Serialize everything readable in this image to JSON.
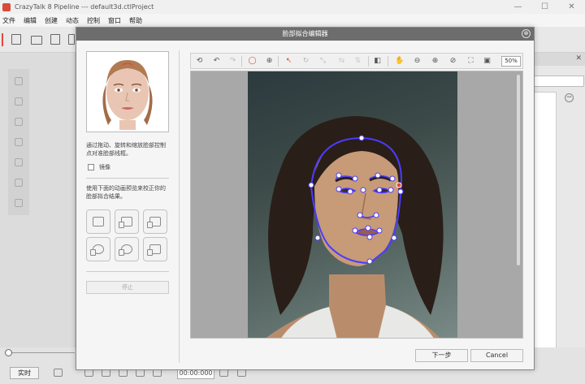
{
  "app": {
    "title": "CrazyTalk 8 Pipeline --- default3d.ctlProject",
    "window_buttons": {
      "minimize": "—",
      "maximize": "☐",
      "close": "✕"
    }
  },
  "menu": [
    "文件",
    "编辑",
    "创建",
    "动态",
    "控制",
    "窗口",
    "帮助"
  ],
  "dialog": {
    "title": "脸部拟合编辑器",
    "close_glyph": "⊗",
    "instructions": "通过拖动、旋转和缩放脸部控制点对准脸部线框。",
    "mirror_label": "镜像",
    "animation_instructions": "使用下面的动画预览来校正你的脸部拟合结果。",
    "stop_label": "停止",
    "next_label": "下一步",
    "cancel_label": "Cancel",
    "zoom_value": "50%"
  },
  "bottom": {
    "realtime_label": "实时",
    "time_value": "00:00:000"
  },
  "colors": {
    "dialog_title_bg": "#6d6d6d",
    "accent_red": "#e4473c",
    "fitting_outline": "#4b3cff"
  },
  "icons": {
    "editor_toolbar": [
      "rotate-icon",
      "undo-icon",
      "redo-icon",
      "face-outline-icon",
      "target-icon",
      "select-arrow-icon",
      "rotate-ctrl-icon",
      "scale-ctrl-icon",
      "flip-icon",
      "contrast-icon",
      "hand-pan-icon",
      "zoom-out-icon",
      "zoom-in-icon",
      "zoom-fit-icon",
      "fit-screen-icon",
      "actual-size-icon"
    ]
  }
}
